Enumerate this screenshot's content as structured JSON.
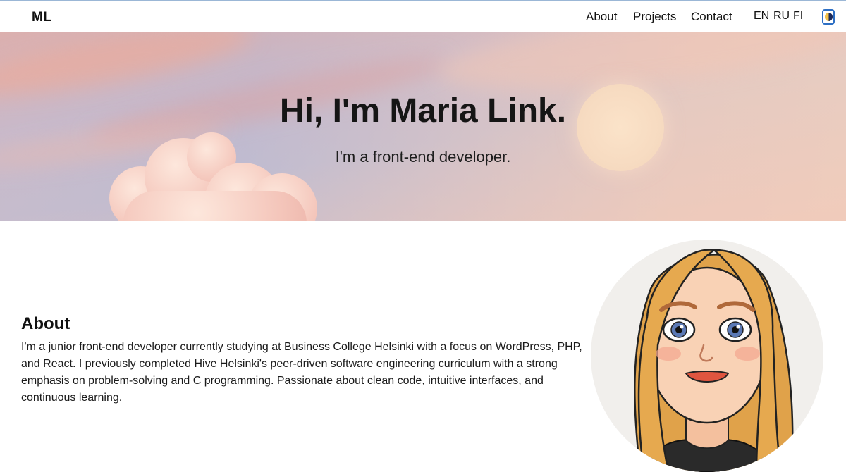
{
  "header": {
    "logo": "ML",
    "nav": [
      "About",
      "Projects",
      "Contact"
    ],
    "languages": [
      "EN",
      "RU",
      "FI"
    ],
    "theme_toggle_icon": "half-moon-icon"
  },
  "hero": {
    "title": "Hi, I'm Maria Link.",
    "subtitle": "I'm a front-end developer."
  },
  "about": {
    "heading": "About",
    "text": "I'm a junior front-end developer currently studying at Business College Helsinki with a focus on WordPress, PHP, and React. I previously completed Hive Helsinki's peer-driven software engineering curriculum with a strong emphasis on problem-solving and C programming. Passionate about clean code, intuitive interfaces, and continuous learning."
  },
  "colors": {
    "accent": "#2d6fc4",
    "text": "#111111",
    "background": "#ffffff"
  }
}
